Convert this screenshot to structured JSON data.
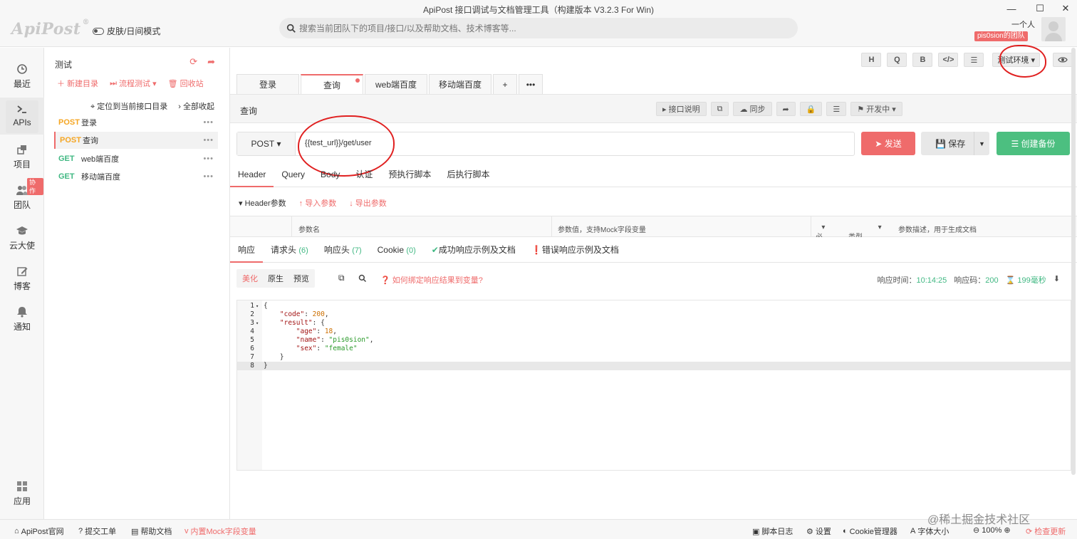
{
  "window": {
    "title": "ApiPost 接口调试与文档管理工具（构建版本 V3.2.3 For Win)",
    "logo": "ApiPost",
    "logo_mark": "®",
    "theme_toggle": "皮肤/日间模式",
    "search_placeholder": "搜索当前团队下的项目/接口/以及帮助文档、技术博客等...",
    "user_name": "一个人",
    "team_badge": "pis0sion的团队",
    "minimize": "—",
    "maximize": "☐",
    "close": "✕"
  },
  "leftnav": {
    "items": [
      {
        "label": "最近",
        "icon": "clock-icon"
      },
      {
        "label": "APIs",
        "icon": "terminal-icon"
      },
      {
        "label": "项目",
        "icon": "layers-icon"
      },
      {
        "label": "团队",
        "icon": "users-icon"
      },
      {
        "label": "云大使",
        "icon": "graduation-cap-icon"
      },
      {
        "label": "博客",
        "icon": "edit-icon"
      },
      {
        "label": "通知",
        "icon": "bell-icon"
      },
      {
        "label": "应用",
        "icon": "grid-icon"
      }
    ],
    "collab_badge": "协作"
  },
  "tree": {
    "title": "测试",
    "new_folder": "新建目录",
    "flow_test": "流程测试",
    "recycle": "回收站",
    "locate": "定位到当前接口目录",
    "collapse_all": "全部收起",
    "rows": [
      {
        "method": "POST",
        "name": "登录"
      },
      {
        "method": "POST",
        "name": "查询"
      },
      {
        "method": "GET",
        "name": "web端百度"
      },
      {
        "method": "GET",
        "name": "移动端百度"
      }
    ],
    "more": "•••"
  },
  "toolbar": {
    "h": "H",
    "q": "Q",
    "b": "B",
    "code": "</>",
    "settings": "☰",
    "env": "测试环境"
  },
  "tabs": [
    {
      "label": "登录"
    },
    {
      "label": "查询"
    },
    {
      "label": "web端百度"
    },
    {
      "label": "移动端百度"
    }
  ],
  "tab_add": "+",
  "tab_more": "•••",
  "api": {
    "name": "查询",
    "doc_btn": "接口说明",
    "sync_btn": "同步",
    "status": "开发中",
    "method": "POST",
    "url": "{{test_url}}/get/user",
    "send": "发送",
    "save": "保存",
    "backup": "创建备份"
  },
  "req_tabs": [
    "Header",
    "Query",
    "Body",
    "认证",
    "预执行脚本",
    "后执行脚本"
  ],
  "header_params": {
    "label": "Header参数",
    "import": "导入参数",
    "export": "导出参数"
  },
  "param_table": {
    "name": "参数名",
    "value": "参数值，支持Mock字段变量",
    "required": "必填",
    "type": "类型",
    "desc": "参数描述，用于生成文档"
  },
  "resp_tabs": [
    {
      "label": "响应",
      "count": ""
    },
    {
      "label": "请求头",
      "count": "(6)"
    },
    {
      "label": "响应头",
      "count": "(7)"
    },
    {
      "label": "Cookie",
      "count": "(0)"
    },
    {
      "label": "成功响应示例及文档",
      "count": ""
    },
    {
      "label": "错误响应示例及文档",
      "count": ""
    }
  ],
  "resp_toolbar": {
    "pretty": "美化",
    "raw": "原生",
    "preview": "预览",
    "hint": "如何绑定响应结果到变量?",
    "time_label": "响应时间：",
    "time": "10:14:25",
    "code_label": "响应码：",
    "code": "200",
    "duration": "199毫秒"
  },
  "code_lines": [
    {
      "n": "1",
      "fold": "▾",
      "text": "{"
    },
    {
      "n": "2",
      "fold": "",
      "text": "    \"code\": 200,"
    },
    {
      "n": "3",
      "fold": "▾",
      "text": "    \"result\": {"
    },
    {
      "n": "4",
      "fold": "",
      "text": "        \"age\": 18,"
    },
    {
      "n": "5",
      "fold": "",
      "text": "        \"name\": \"pis0sion\","
    },
    {
      "n": "6",
      "fold": "",
      "text": "        \"sex\": \"female\""
    },
    {
      "n": "7",
      "fold": "",
      "text": "    }"
    },
    {
      "n": "8",
      "fold": "",
      "text": "}"
    }
  ],
  "status": {
    "site": "ApiPost官网",
    "ticket": "提交工单",
    "help": "帮助文档",
    "mock": "内置Mock字段变量",
    "script_log": "脚本日志",
    "settings": "设置",
    "cookie": "Cookie管理器",
    "font_size": "字体大小",
    "zoom": "100%",
    "update": "检查更新"
  },
  "watermark": "@稀土掘金技术社区",
  "colors": {
    "accent": "#ef6b6b",
    "post": "#f5a623",
    "get": "#41b883",
    "success": "#4cbf80"
  }
}
